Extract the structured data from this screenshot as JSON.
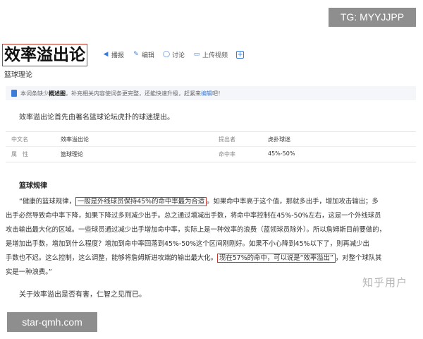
{
  "watermarks": {
    "top": "TG: MYYJJPP",
    "bottom": "star-qmh.com",
    "zhihu": "知乎用户"
  },
  "entry": {
    "title": "效率溢出论",
    "subtitle": "篮球理论"
  },
  "toolbar": {
    "play": "播报",
    "edit": "编辑",
    "discuss": "讨论",
    "upload_video": "上传视频"
  },
  "notice": {
    "prefix": "本词条缺少",
    "bold": "概述图",
    "middle": "，补充相关内容使词条更完整，还能快速升级，赶紧来",
    "link": "编辑",
    "suffix": "吧！"
  },
  "intro": "效率溢出论首先由著名篮球论坛虎扑的球迷提出。",
  "infobox": {
    "row1": {
      "label1": "中文名",
      "value1": "效率溢出论",
      "label2": "提出者",
      "value2": "虎扑球迷"
    },
    "row2": {
      "label1": "属　性",
      "value1": "篮球理论",
      "label2": "命中率",
      "value2": "45%-50%"
    }
  },
  "section_title": "篮球规律",
  "quote": {
    "l1_a": "“健康的篮球规律，",
    "l1_hl": "一般是外线球员保持45%的命中率最为合适",
    "l1_b": "。如果命中率高于这个值，那就多出手，增加攻击输出；多",
    "l2": "出手必然导致命中率下降，如果下降过多则减少出手。总之通过增减出手数，将命中率控制在45%-50%左右，这是一个外线球员",
    "l3": "攻击输出最大化的区域。一些球员通过减少出手增加命中率，实际上是一种效率的浪费（蓝领球员除外）。所以詹姆斯目前要做的，",
    "l4": "是增加出手数，增加到什么程度？增加到命中率回落到45%-50%这个区间刚刚好。如果不小心降到45%以下了，则再减少出",
    "l5_a": "手数也不迟。这么控制，这么调整，能够将詹姆斯进攻端的输出最大化。",
    "l5_hl": "现在57%的命中，可以说是“效率溢出”",
    "l5_b": "，对整个球队其",
    "l6": "实是一种浪费。”"
  },
  "conclusion": "关于效率溢出是否有害，仁智之见而已。",
  "colors": {
    "accent": "#3d7bd8",
    "highlight_border": "#c0392b",
    "watermark_bg": "#8e8e8e"
  }
}
